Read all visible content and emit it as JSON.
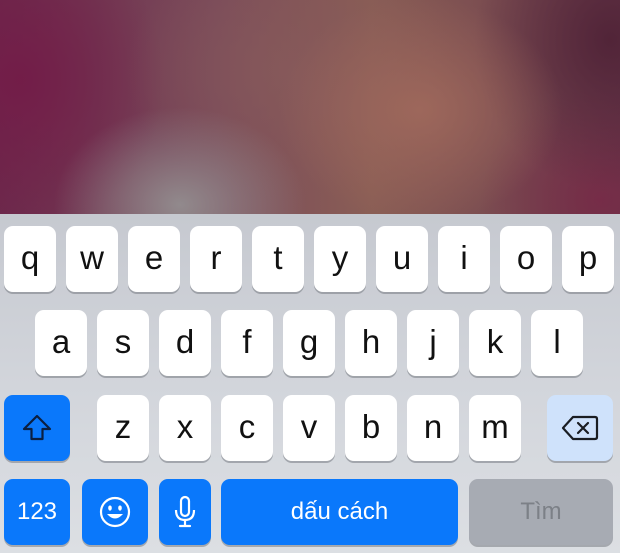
{
  "keyboard": {
    "row1": [
      "q",
      "w",
      "e",
      "r",
      "t",
      "y",
      "u",
      "i",
      "o",
      "p"
    ],
    "row2": [
      "a",
      "s",
      "d",
      "f",
      "g",
      "h",
      "j",
      "k",
      "l"
    ],
    "row3": [
      "z",
      "x",
      "c",
      "v",
      "b",
      "n",
      "m"
    ],
    "numbers_label": "123",
    "space_label": "dấu cách",
    "return_label": "Tìm",
    "icons": {
      "shift": "shift-arrow-icon",
      "delete": "backspace-icon",
      "emoji": "smiley-icon",
      "dictation": "microphone-icon"
    },
    "colors": {
      "accent": "#0a78fb",
      "delete_key": "#cfe2fb",
      "disabled_key": "#a7abb3",
      "letter_key": "#ffffff"
    }
  }
}
